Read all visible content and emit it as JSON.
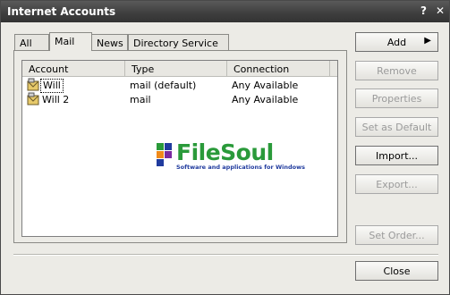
{
  "window": {
    "title": "Internet Accounts",
    "help_glyph": "?",
    "close_glyph": "✕"
  },
  "tabs": [
    {
      "label": "All"
    },
    {
      "label": "Mail",
      "active": true
    },
    {
      "label": "News"
    },
    {
      "label": "Directory Service"
    }
  ],
  "table": {
    "columns": [
      "Account",
      "Type",
      "Connection"
    ],
    "rows": [
      {
        "account": "Will",
        "type": "mail (default)",
        "connection": "Any Available"
      },
      {
        "account": "Will 2",
        "type": "mail",
        "connection": "Any Available"
      }
    ]
  },
  "watermark": {
    "brand": "FileSoul",
    "tagline": "Software and applications for Windows"
  },
  "buttons": {
    "add": "Add",
    "remove": "Remove",
    "properties": "Properties",
    "set_default": "Set as Default",
    "import": "Import...",
    "export": "Export...",
    "set_order": "Set Order...",
    "close": "Close"
  }
}
